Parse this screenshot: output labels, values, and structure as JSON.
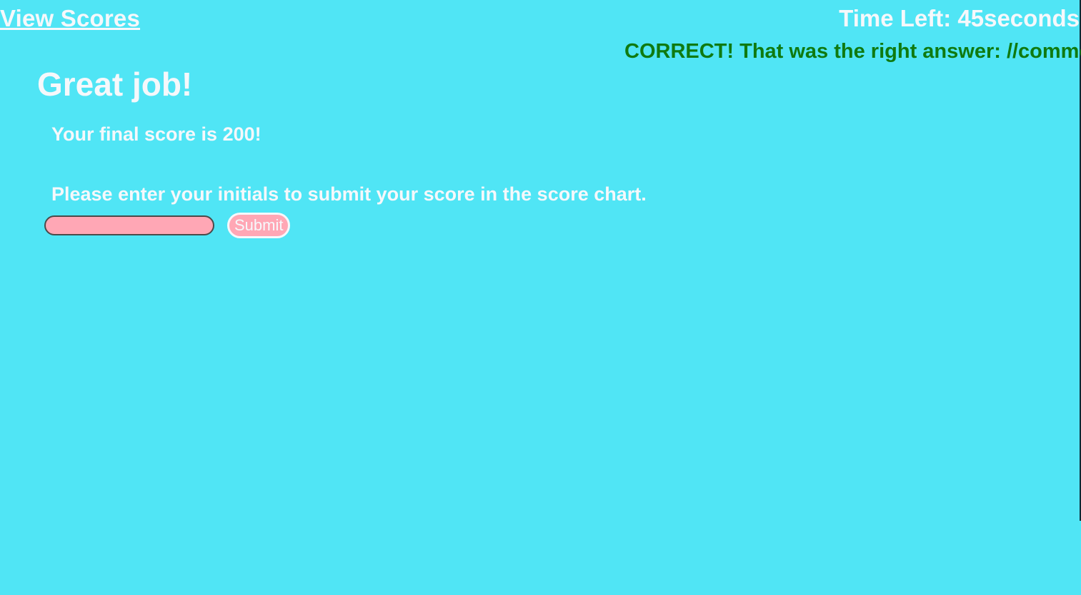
{
  "nav": {
    "view_scores": "View Scores"
  },
  "timer": {
    "text": "Time Left: 45seconds"
  },
  "feedback": {
    "text": "CORRECT! That was the right answer: //comment",
    "color": "#0f7a10"
  },
  "result": {
    "title": "Great job!",
    "final_score": "Your final score is 200!",
    "instructions": "Please enter your initials to submit your score in the score chart."
  },
  "form": {
    "initials_value": "",
    "submit_label": "Submit"
  },
  "colors": {
    "background": "#50e5f5",
    "text": "#f6f8fb",
    "input": "#ffa7b5"
  }
}
